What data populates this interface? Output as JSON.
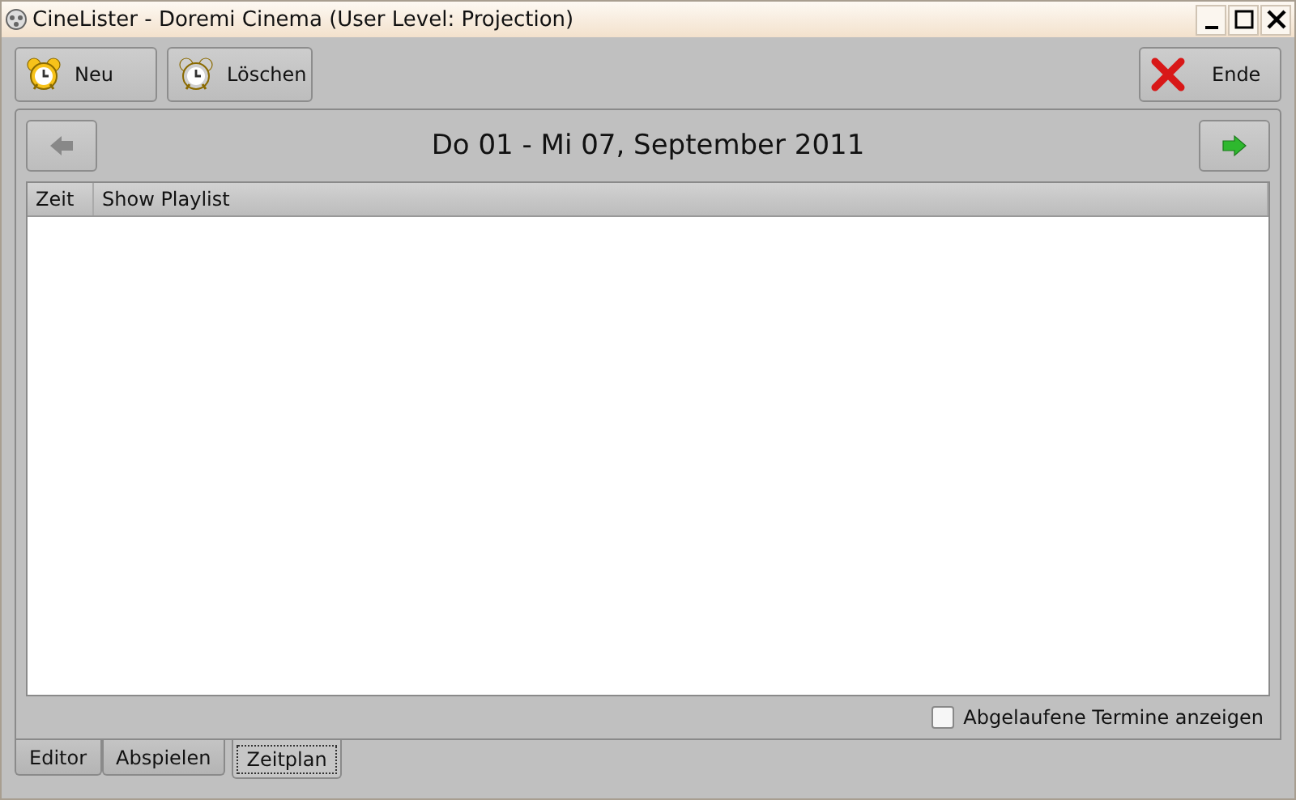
{
  "window": {
    "title": "CineLister - Doremi Cinema (User Level: Projection)"
  },
  "toolbar": [
    {
      "label": "Neu",
      "kind": "new"
    },
    {
      "label": "Löschen",
      "kind": "delete"
    }
  ],
  "exit_button": {
    "label": "Ende"
  },
  "week": {
    "title": "Do 01 - Mi 07, September 2011"
  },
  "table": {
    "columns": [
      "Zeit",
      "Show Playlist"
    ]
  },
  "show_expired": {
    "label": "Abgelaufene Termine anzeigen",
    "checked": false
  },
  "tabs": [
    {
      "label": "Editor",
      "selected": false
    },
    {
      "label": "Abspielen",
      "selected": false
    },
    {
      "label": "Zeitplan",
      "selected": true
    }
  ]
}
